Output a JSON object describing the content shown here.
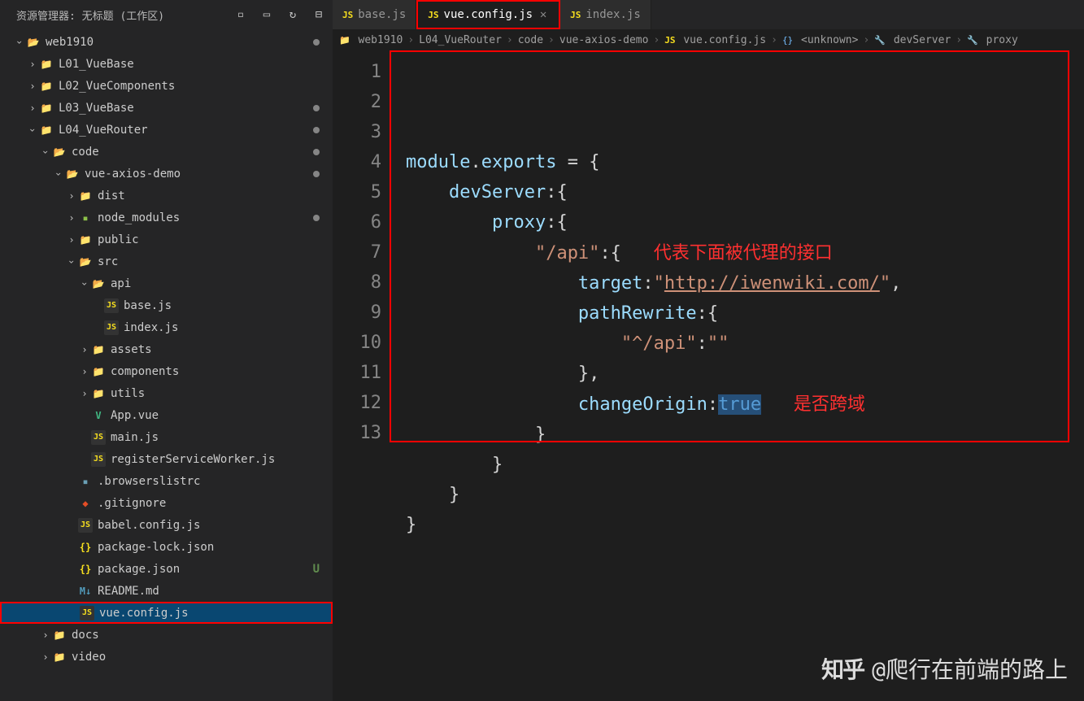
{
  "sidebar": {
    "title": "资源管理器: 无标题 (工作区)",
    "actionIcons": [
      "new-file",
      "new-folder",
      "refresh",
      "collapse"
    ],
    "tree": [
      {
        "depth": 0,
        "kind": "root",
        "label": "web1910",
        "expanded": true,
        "mod": true
      },
      {
        "depth": 1,
        "kind": "folder",
        "label": "L01_VueBase",
        "expanded": false
      },
      {
        "depth": 1,
        "kind": "folder",
        "label": "L02_VueComponents",
        "expanded": false
      },
      {
        "depth": 1,
        "kind": "folder",
        "label": "L03_VueBase",
        "expanded": false,
        "mod": true
      },
      {
        "depth": 1,
        "kind": "folder",
        "label": "L04_VueRouter",
        "expanded": true,
        "mod": true
      },
      {
        "depth": 2,
        "kind": "folder-open",
        "label": "code",
        "expanded": true,
        "mod": true
      },
      {
        "depth": 3,
        "kind": "folder-open",
        "label": "vue-axios-demo",
        "expanded": true,
        "mod": true
      },
      {
        "depth": 4,
        "kind": "folder",
        "label": "dist",
        "expanded": false
      },
      {
        "depth": 4,
        "kind": "folder-green",
        "label": "node_modules",
        "expanded": false,
        "mod": true
      },
      {
        "depth": 4,
        "kind": "folder",
        "label": "public",
        "expanded": false
      },
      {
        "depth": 4,
        "kind": "folder-open",
        "label": "src",
        "expanded": true
      },
      {
        "depth": 5,
        "kind": "folder-open",
        "label": "api",
        "expanded": true
      },
      {
        "depth": 6,
        "kind": "js",
        "label": "base.js"
      },
      {
        "depth": 6,
        "kind": "js",
        "label": "index.js"
      },
      {
        "depth": 5,
        "kind": "folder",
        "label": "assets",
        "expanded": false
      },
      {
        "depth": 5,
        "kind": "folder",
        "label": "components",
        "expanded": false
      },
      {
        "depth": 5,
        "kind": "folder",
        "label": "utils",
        "expanded": false
      },
      {
        "depth": 5,
        "kind": "vue",
        "label": "App.vue"
      },
      {
        "depth": 5,
        "kind": "js",
        "label": "main.js"
      },
      {
        "depth": 5,
        "kind": "js",
        "label": "registerServiceWorker.js"
      },
      {
        "depth": 4,
        "kind": "file",
        "label": ".browserslistrc"
      },
      {
        "depth": 4,
        "kind": "git",
        "label": ".gitignore"
      },
      {
        "depth": 4,
        "kind": "js",
        "label": "babel.config.js"
      },
      {
        "depth": 4,
        "kind": "json",
        "label": "package-lock.json"
      },
      {
        "depth": 4,
        "kind": "json",
        "label": "package.json",
        "u": true
      },
      {
        "depth": 4,
        "kind": "md",
        "label": "README.md"
      },
      {
        "depth": 4,
        "kind": "js",
        "label": "vue.config.js",
        "selected": true,
        "boxed": true
      },
      {
        "depth": 2,
        "kind": "folder",
        "label": "docs",
        "expanded": false
      },
      {
        "depth": 2,
        "kind": "folder",
        "label": "video",
        "expanded": false
      }
    ]
  },
  "tabs": [
    {
      "label": "base.js",
      "icon": "JS",
      "active": false,
      "close": false
    },
    {
      "label": "vue.config.js",
      "icon": "JS",
      "active": true,
      "close": true,
      "boxed": true
    },
    {
      "label": "index.js",
      "icon": "JS",
      "active": false,
      "close": false
    }
  ],
  "breadcrumb": [
    {
      "icon": "folder",
      "text": "web1910"
    },
    {
      "text": "L04_VueRouter"
    },
    {
      "text": "code"
    },
    {
      "text": "vue-axios-demo"
    },
    {
      "icon": "JS",
      "text": "vue.config.js"
    },
    {
      "icon": "{}",
      "text": "<unknown>"
    },
    {
      "icon": "🔧",
      "text": "devServer"
    },
    {
      "icon": "🔧",
      "text": "proxy"
    }
  ],
  "code": {
    "annotations": {
      "a1": "代表下面被代理的接口",
      "a2": "是否跨域"
    },
    "lines": [
      "module.exports = {",
      "    devServer:{",
      "        proxy:{",
      "            \"/api\":{",
      "                target:\"http://iwenwiki.com/\",",
      "                pathRewrite:{",
      "                    \"^/api\":\"\"",
      "                },",
      "                changeOrigin:true",
      "            }",
      "        }",
      "    }",
      "}"
    ]
  },
  "watermark": {
    "logo": "知乎",
    "text": "@爬行在前端的路上"
  }
}
